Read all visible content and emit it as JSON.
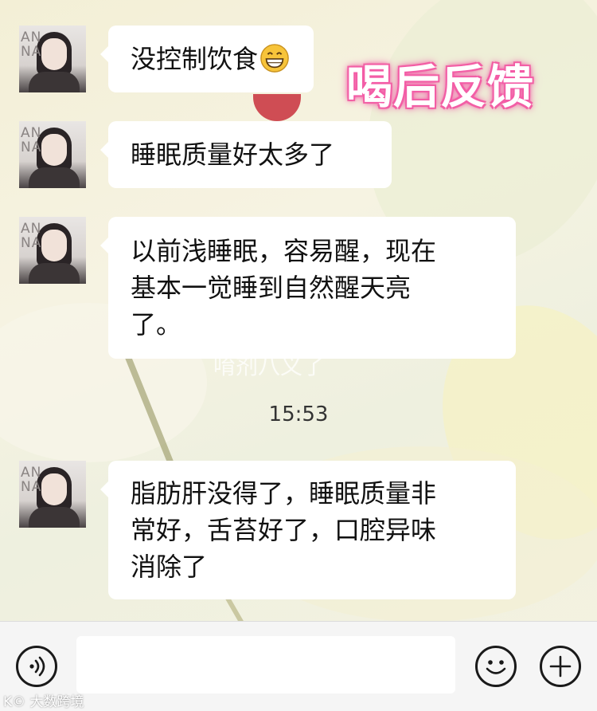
{
  "header_tag": "喝后反馈",
  "messages": [
    {
      "text": "没控制饮食",
      "emoji": "grinning-face"
    },
    {
      "text": "睡眠质量好太多了"
    },
    {
      "lines": [
        "以前浅睡眠，容易醒，现在",
        "基本一觉睡到自然醒天亮",
        "了。"
      ]
    },
    {
      "lines": [
        "脂肪肝没得了，睡眠质量非",
        "常好，舌苔好了，口腔异味",
        "消除了"
      ]
    }
  ],
  "avatar_text": [
    "AN",
    "NA"
  ],
  "background_text": "唷剂八义了",
  "timestamp": "15:53",
  "input_bar": {
    "voice_icon": "voice-icon",
    "emoji_icon": "emoji-icon",
    "plus_icon": "plus-icon"
  },
  "watermark": "K© 大数跨境"
}
